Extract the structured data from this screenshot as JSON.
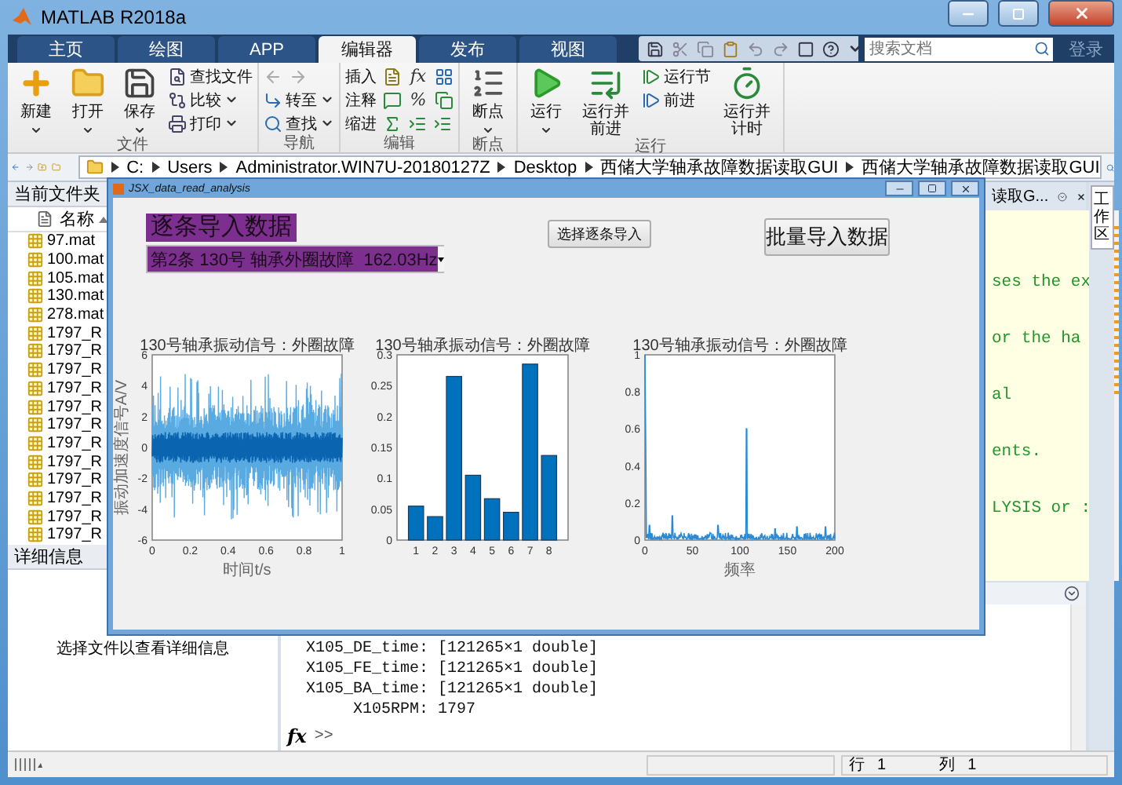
{
  "window": {
    "title": "MATLAB R2018a"
  },
  "tabs": [
    {
      "label": "主页",
      "selected": false
    },
    {
      "label": "绘图",
      "selected": false
    },
    {
      "label": "APP",
      "selected": false
    },
    {
      "label": "编辑器",
      "selected": true
    },
    {
      "label": "发布",
      "selected": false
    },
    {
      "label": "视图",
      "selected": false
    }
  ],
  "search": {
    "placeholder": "搜索文档"
  },
  "login": "登录",
  "toolstrip": {
    "groups": [
      {
        "label": "文件",
        "items": [
          {
            "kind": "large",
            "label": "新建",
            "dropdown": true
          },
          {
            "kind": "large",
            "label": "打开",
            "dropdown": true
          },
          {
            "kind": "large",
            "label": "保存",
            "dropdown": true
          },
          {
            "kind": "stack",
            "entries": [
              {
                "kind": "button",
                "label": "查找文件",
                "dropdown": false
              },
              {
                "kind": "button",
                "label": "比较",
                "dropdown": true
              },
              {
                "kind": "button",
                "label": "打印",
                "dropdown": true
              }
            ]
          }
        ]
      },
      {
        "label": "导航",
        "items": [
          {
            "kind": "stack",
            "entries": [
              {
                "kind": "arrows"
              },
              {
                "kind": "button",
                "label": "转至",
                "dropdown": true
              },
              {
                "kind": "button",
                "label": "查找",
                "dropdown": true
              }
            ]
          }
        ]
      },
      {
        "label": "编辑",
        "items": [
          {
            "kind": "stack",
            "entries": [
              {
                "kind": "tools",
                "label": "插入",
                "glyph": "fx"
              },
              {
                "kind": "tools",
                "label": "注释",
                "glyph": "%"
              },
              {
                "kind": "tools",
                "label": "缩进"
              }
            ]
          }
        ]
      },
      {
        "label": "断点",
        "items": [
          {
            "kind": "large",
            "label": "断点",
            "dropdown": true
          }
        ]
      },
      {
        "label": "运行",
        "items": [
          {
            "kind": "large",
            "label": "运行",
            "dropdown": true
          },
          {
            "kind": "large",
            "label": "运行并前进",
            "dropdown": false
          },
          {
            "kind": "stack",
            "entries": [
              {
                "kind": "button",
                "label": "运行节",
                "dropdown": false
              },
              {
                "kind": "button",
                "label": "前进",
                "dropdown": false
              }
            ]
          },
          {
            "kind": "large",
            "label": "运行并计时",
            "dropdown": false
          }
        ]
      }
    ]
  },
  "address": {
    "path": [
      "C:",
      "Users",
      "Administrator.WIN7U-20180127Z",
      "Desktop",
      "西储大学轴承故障数据读取GUI",
      "西储大学轴承故障数据读取GUI"
    ]
  },
  "current_folder": {
    "title": "当前文件夹",
    "column": "名称",
    "files": [
      "97.mat",
      "100.mat",
      "105.mat",
      "130.mat",
      "278.mat",
      "1797_R",
      "1797_R",
      "1797_R",
      "1797_R",
      "1797_R",
      "1797_R",
      "1797_R",
      "1797_R",
      "1797_R",
      "1797_R",
      "1797_R",
      "1797_R"
    ],
    "details_title": "详细信息",
    "details_text": "选择文件以查看详细信息"
  },
  "editor": {
    "tab_title": "读取G...",
    "code_lines": [
      "ses the ex",
      "or the ha",
      "al",
      "ents.",
      "LYSIS or :"
    ]
  },
  "command_window": {
    "lines": [
      {
        "name": "X105_DE_time:",
        "value": "[121265×1 double]"
      },
      {
        "name": "X105_FE_time:",
        "value": "[121265×1 double]"
      },
      {
        "name": "X105_BA_time:",
        "value": "[121265×1 double]"
      },
      {
        "name": "X105RPM:",
        "value": "1797"
      }
    ],
    "prompt_icon": "fx",
    "prompt": ">>"
  },
  "workspace_tab": "工作区",
  "status_bar": {
    "row_label": "行",
    "row": "1",
    "col_label": "列",
    "col": "1"
  },
  "dialog": {
    "title": "JSX_data_read_analysis",
    "label": "逐条导入数据",
    "select": {
      "value": "第2条 130号 轴承外圈故障  162.03Hz"
    },
    "buttons": [
      "选择逐条导入",
      "批量导入数据"
    ],
    "plots": [
      {
        "kind": "waveform",
        "title": "130号轴承振动信号：外圈故障",
        "xlabel": "时间t/s",
        "ylabel": "振动加速度信号A/V",
        "xtick_labels": [
          "0",
          "0.2",
          "0.4",
          "0.6",
          "0.8",
          "1"
        ],
        "ytick_labels": [
          "6",
          "4",
          "2",
          "0",
          "-2",
          "-4",
          "-6"
        ]
      },
      {
        "kind": "bar",
        "chart_data": {
          "type": "bar",
          "title": "130号轴承振动信号：外圈故障",
          "categories": [
            "1",
            "2",
            "3",
            "4",
            "5",
            "6",
            "7",
            "8"
          ],
          "values": [
            0.055,
            0.038,
            0.265,
            0.105,
            0.067,
            0.045,
            0.285,
            0.137
          ],
          "ylim": [
            0,
            0.3
          ],
          "yticks": [
            0,
            0.05,
            0.1,
            0.15,
            0.2,
            0.25,
            0.3
          ]
        }
      },
      {
        "kind": "spectrum",
        "title": "130号轴承振动信号：外圈故障",
        "xlabel": "频率",
        "xtick_labels": [
          "0",
          "50",
          "100",
          "150",
          "200"
        ],
        "ytick_labels": [
          "1",
          "0.8",
          "0.6",
          "0.4",
          "0.2",
          "0"
        ]
      }
    ]
  }
}
